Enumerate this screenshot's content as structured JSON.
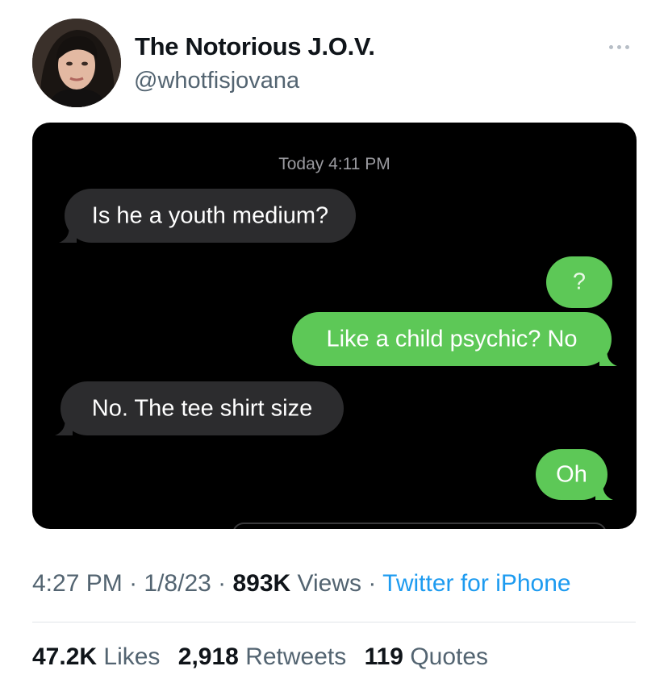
{
  "author": {
    "display_name": "The Notorious J.O.V.",
    "handle": "@whotfisjovana"
  },
  "icons": {
    "more": "more-horizontal-icon",
    "avatar": "profile-photo"
  },
  "media": {
    "timestamp": "Today 4:11 PM",
    "messages": [
      {
        "side": "received",
        "text": "Is he a youth medium?"
      },
      {
        "side": "sent",
        "text": "?"
      },
      {
        "side": "sent",
        "text": "Like a child psychic? No"
      },
      {
        "side": "received",
        "text": "No. The tee shirt size"
      },
      {
        "side": "sent",
        "text": "Oh"
      }
    ],
    "colors": {
      "sent": "#5dc857",
      "received": "#2c2c2e",
      "background": "#000000"
    }
  },
  "meta": {
    "time": "4:27 PM",
    "sep1": " · ",
    "date": "1/8/23",
    "sep2": " · ",
    "views_count": "893K",
    "views_label": " Views",
    "sep3": " · ",
    "client": "Twitter for iPhone"
  },
  "stats": {
    "likes_count": "47.2K",
    "likes_label": " Likes",
    "retweets_count": "2,918",
    "retweets_label": " Retweets",
    "quotes_count": "119",
    "quotes_label": " Quotes"
  },
  "colors": {
    "accent": "#1d9bf0",
    "secondary_text": "#536471",
    "primary_text": "#0f1419"
  }
}
